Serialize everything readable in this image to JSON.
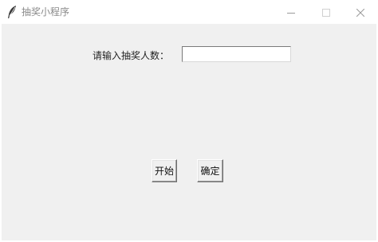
{
  "window": {
    "title": "抽奖小程序",
    "icon": "feather-icon",
    "controls": {
      "minimize": "minimize-icon",
      "maximize": "maximize-icon",
      "close": "close-icon"
    }
  },
  "form": {
    "count_label": "请输入抽奖人数：",
    "count_value": ""
  },
  "buttons": {
    "start_label": "开始",
    "confirm_label": "确定"
  },
  "colors": {
    "client_bg": "#f0f0f0",
    "title_text": "#8a8a8a"
  }
}
